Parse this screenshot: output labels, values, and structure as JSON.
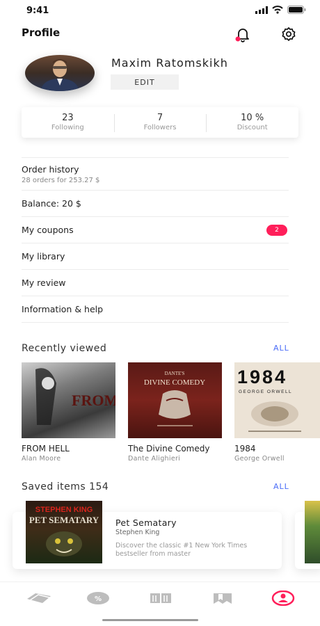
{
  "status_bar": {
    "time": "9:41"
  },
  "header": {
    "title": "Profile"
  },
  "profile": {
    "name": "Maxim Ratomskikh",
    "edit_label": "EDIT"
  },
  "stats": [
    {
      "value": "23",
      "label": "Following"
    },
    {
      "value": "7",
      "label": "Followers"
    },
    {
      "value": "10 %",
      "label": "Discount"
    }
  ],
  "menu": {
    "order_history": {
      "label": "Order history",
      "sub": "28 orders for 253.27 $"
    },
    "balance": "Balance: 20 $",
    "coupons": {
      "label": "My coupons",
      "badge": "2"
    },
    "library": "My library",
    "review": "My review",
    "info": "Information & help"
  },
  "recent": {
    "title": "Recently viewed",
    "all_label": "ALL",
    "books": [
      {
        "title": "FROM HELL",
        "author": "Alan Moore",
        "cover_text": "FROM HELL"
      },
      {
        "title": "The Divine Comedy",
        "author": "Dante Alighieri",
        "cover_text": "DIVINE COMEDY",
        "cover_pre": "DANTE'S"
      },
      {
        "title": "1984",
        "author": "George Orwell",
        "cover_text": "1984",
        "cover_sub": "GEORGE ORWELL"
      }
    ]
  },
  "saved": {
    "title": "Saved items 154",
    "all_label": "ALL",
    "item": {
      "title": "Pet Sematary",
      "author": "Stephen King",
      "description": "Discover the classic #1 New York Times bestseller from master",
      "cover_author": "STEPHEN KING",
      "cover_title": "PET SEMATARY"
    }
  },
  "colors": {
    "accent": "#ff1f5a",
    "link": "#4a6cf7"
  },
  "tabbar": {
    "icons": [
      "tickets-icon",
      "discount-icon",
      "library-icon",
      "bookmark-icon",
      "profile-icon"
    ],
    "active": "profile-icon"
  }
}
